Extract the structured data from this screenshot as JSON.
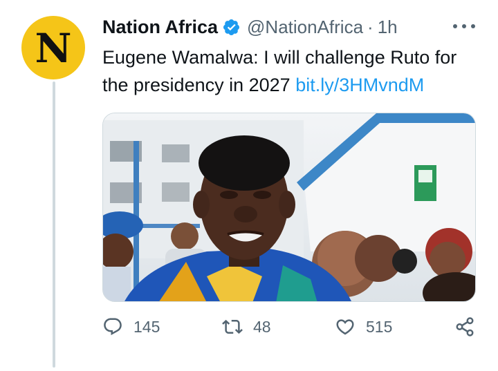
{
  "tweet": {
    "author_name": "Nation Africa",
    "avatar_letter": "N",
    "handle": "@NationAfrica",
    "separator": "·",
    "time": "1h",
    "text": "Eugene Wamalwa: I will challenge Ruto for the presidency in 2027",
    "link": "bit.ly/3HMvndM",
    "verified": true,
    "colors": {
      "accent": "#1d9bf0",
      "avatar_bg": "#f5c518",
      "muted": "#536471"
    }
  },
  "actions": {
    "replies": "145",
    "retweets": "48",
    "likes": "515"
  },
  "icons": {
    "more": "more-options-icon",
    "reply": "reply-icon",
    "retweet": "retweet-icon",
    "like": "heart-icon",
    "share": "share-icon",
    "verified": "verified-badge-icon"
  }
}
